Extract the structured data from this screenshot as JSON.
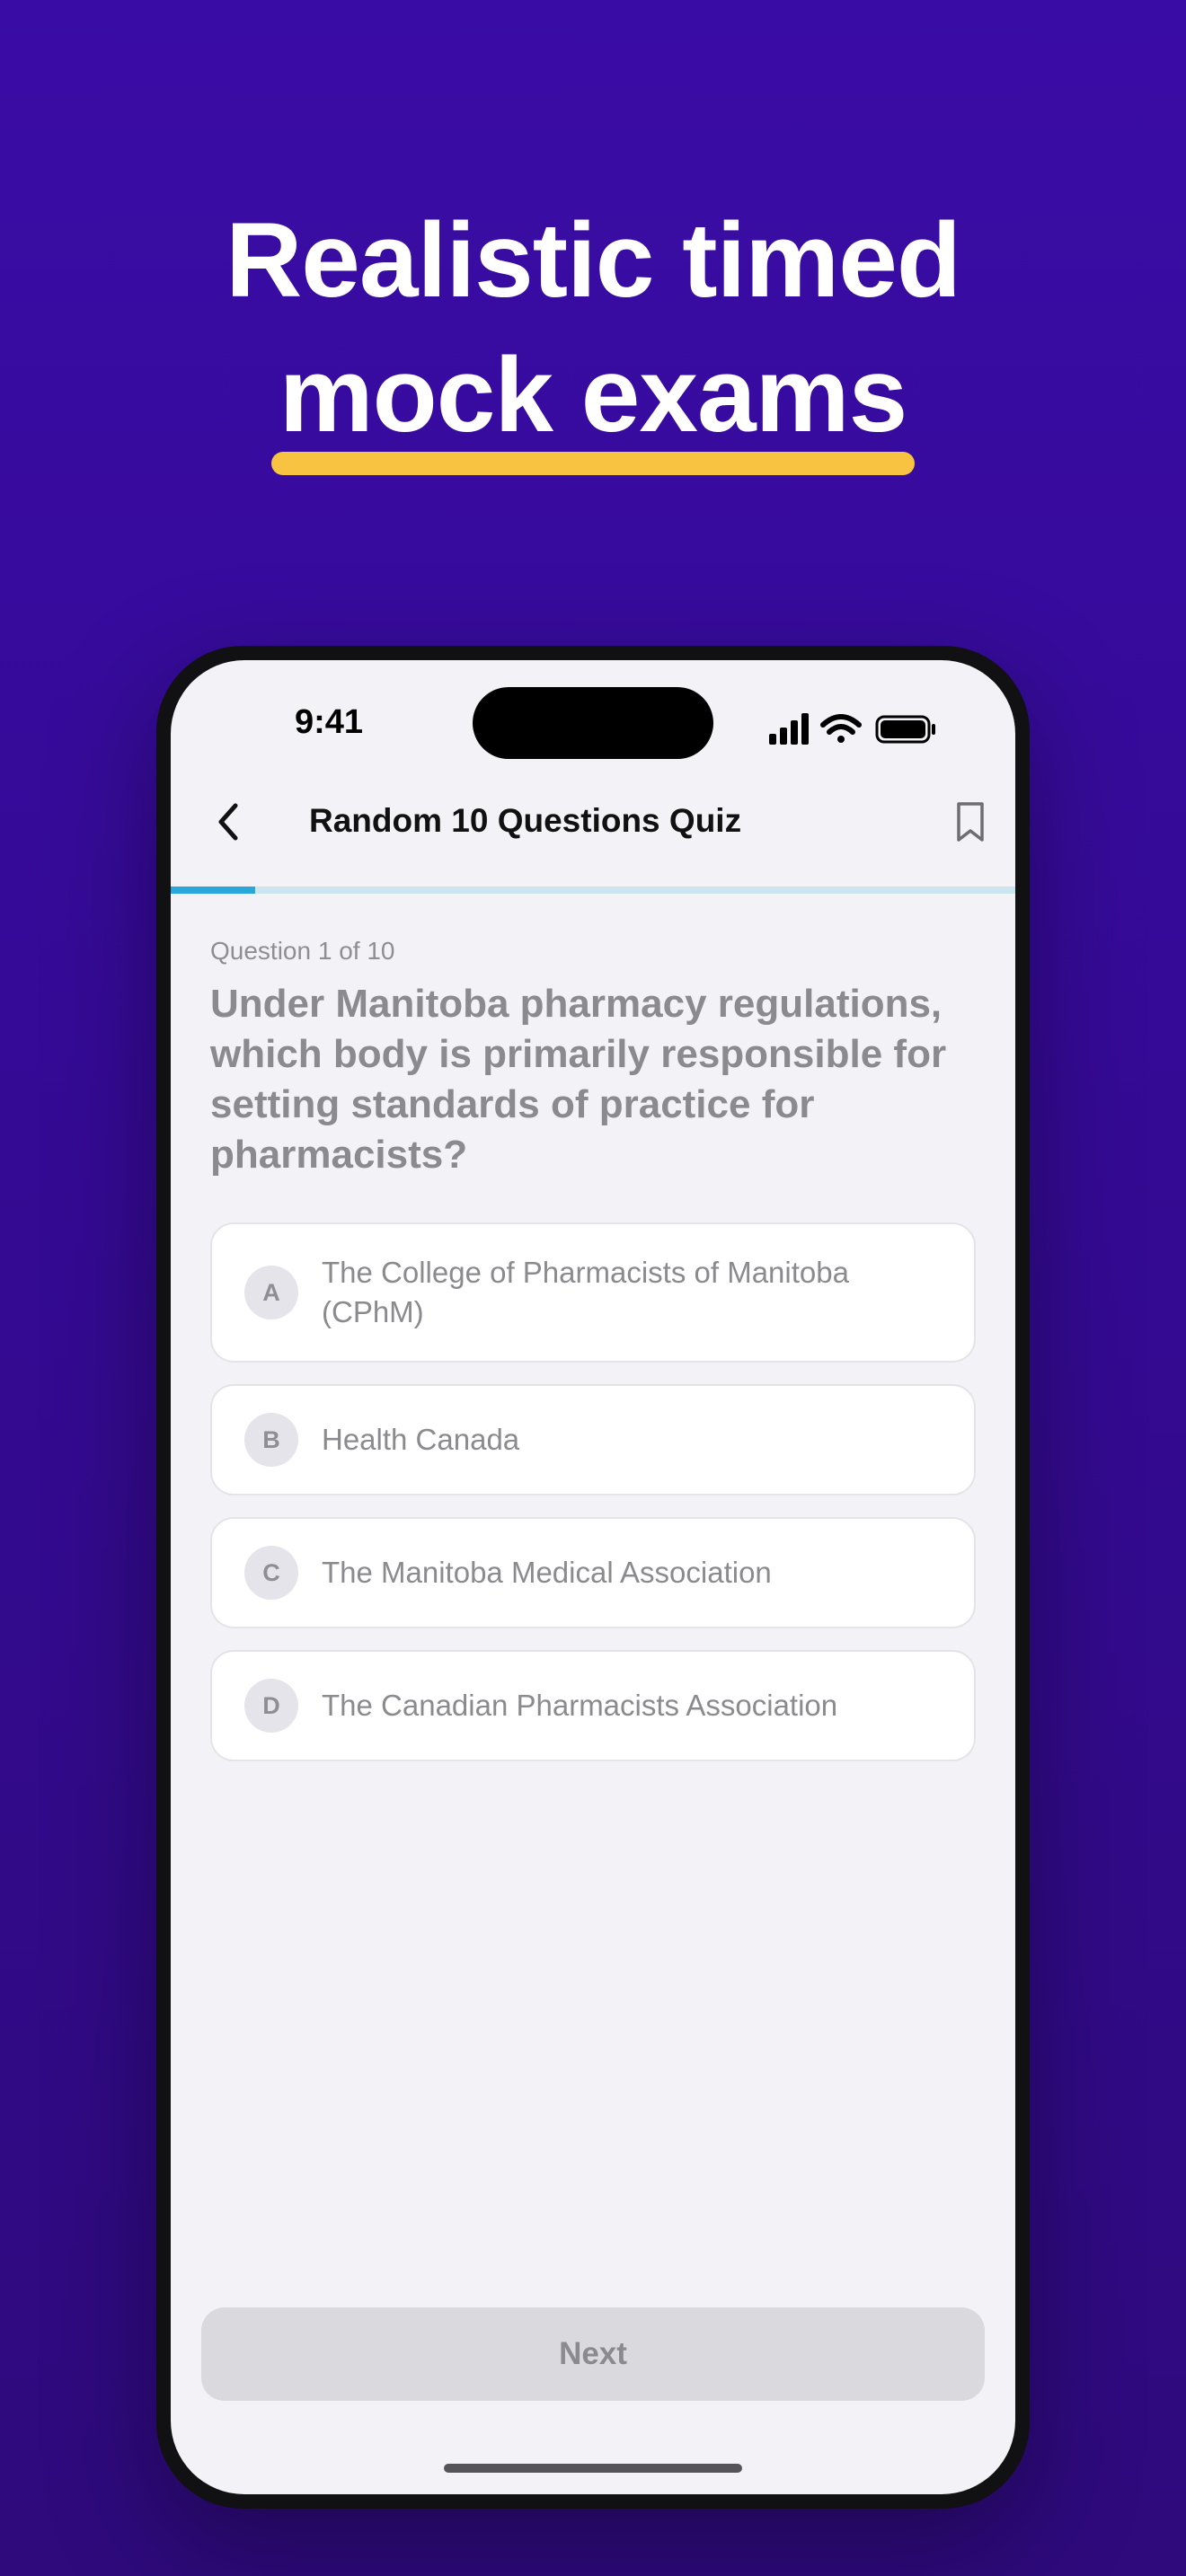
{
  "headline": {
    "line1": "Realistic timed",
    "line2": "mock exams"
  },
  "colors": {
    "background": "#3a0ca6",
    "accent_underline": "#f7c341",
    "progress": "#2aa6d8"
  },
  "status_bar": {
    "time": "9:41"
  },
  "nav": {
    "title": "Random 10 Questions Quiz",
    "back_icon": "chevron-left-icon",
    "bookmark_icon": "bookmark-icon"
  },
  "progress": {
    "current": 1,
    "total": 10,
    "fraction": 0.1
  },
  "question": {
    "counter": "Question 1 of 10",
    "text": "Under Manitoba pharmacy regulations, which body is primarily responsible for setting standards of practice for pharmacists?"
  },
  "options": [
    {
      "letter": "A",
      "text": "The College of Pharmacists of Manitoba (CPhM)"
    },
    {
      "letter": "B",
      "text": "Health Canada"
    },
    {
      "letter": "C",
      "text": "The Manitoba Medical Association"
    },
    {
      "letter": "D",
      "text": "The Canadian Pharmacists Association"
    }
  ],
  "footer": {
    "next_label": "Next"
  }
}
